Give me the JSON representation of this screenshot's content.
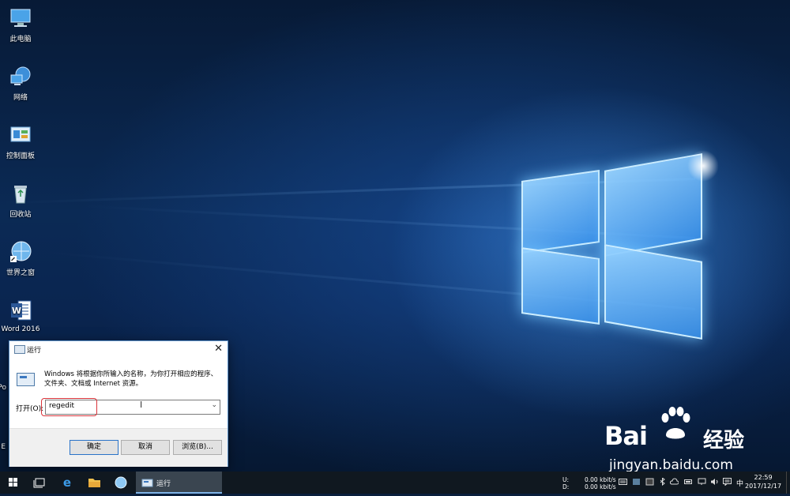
{
  "desktop_icons": [
    {
      "label": "此电脑",
      "icon": "computer-icon"
    },
    {
      "label": "网络",
      "icon": "network-icon"
    },
    {
      "label": "控制面板",
      "icon": "control-panel-icon"
    },
    {
      "label": "回收站",
      "icon": "recycle-bin-icon"
    },
    {
      "label": "世界之窗",
      "icon": "browser-globe-icon"
    },
    {
      "label": "Word 2016",
      "icon": "word-icon"
    }
  ],
  "partial_icon_labels": [
    "Po",
    "E"
  ],
  "run_dialog": {
    "title": "运行",
    "close_glyph": "✕",
    "description": "Windows 将根据你所输入的名称，为你打开相应的程序、文件夹、文档或 Internet 资源。",
    "open_label": "打开(O):",
    "open_value": "regedit",
    "ok_label": "确定",
    "cancel_label": "取消",
    "browse_label": "浏览(B)..."
  },
  "watermark": {
    "brand": "Bai",
    "brand_suffix": "经验",
    "url": "jingyan.baidu.com"
  },
  "taskbar": {
    "running_task_label": "运行",
    "net_up_label": "U:",
    "net_down_label": "D:",
    "net_up_value": "0.00 kbit/s",
    "net_down_value": "0.00 kbit/s",
    "ime_label": "中",
    "time": "22:59",
    "date": "2017/12/17"
  },
  "colors": {
    "highlight_border": "#d9343a",
    "taskbar_bg": "#101820",
    "accent": "#2a73c8"
  }
}
